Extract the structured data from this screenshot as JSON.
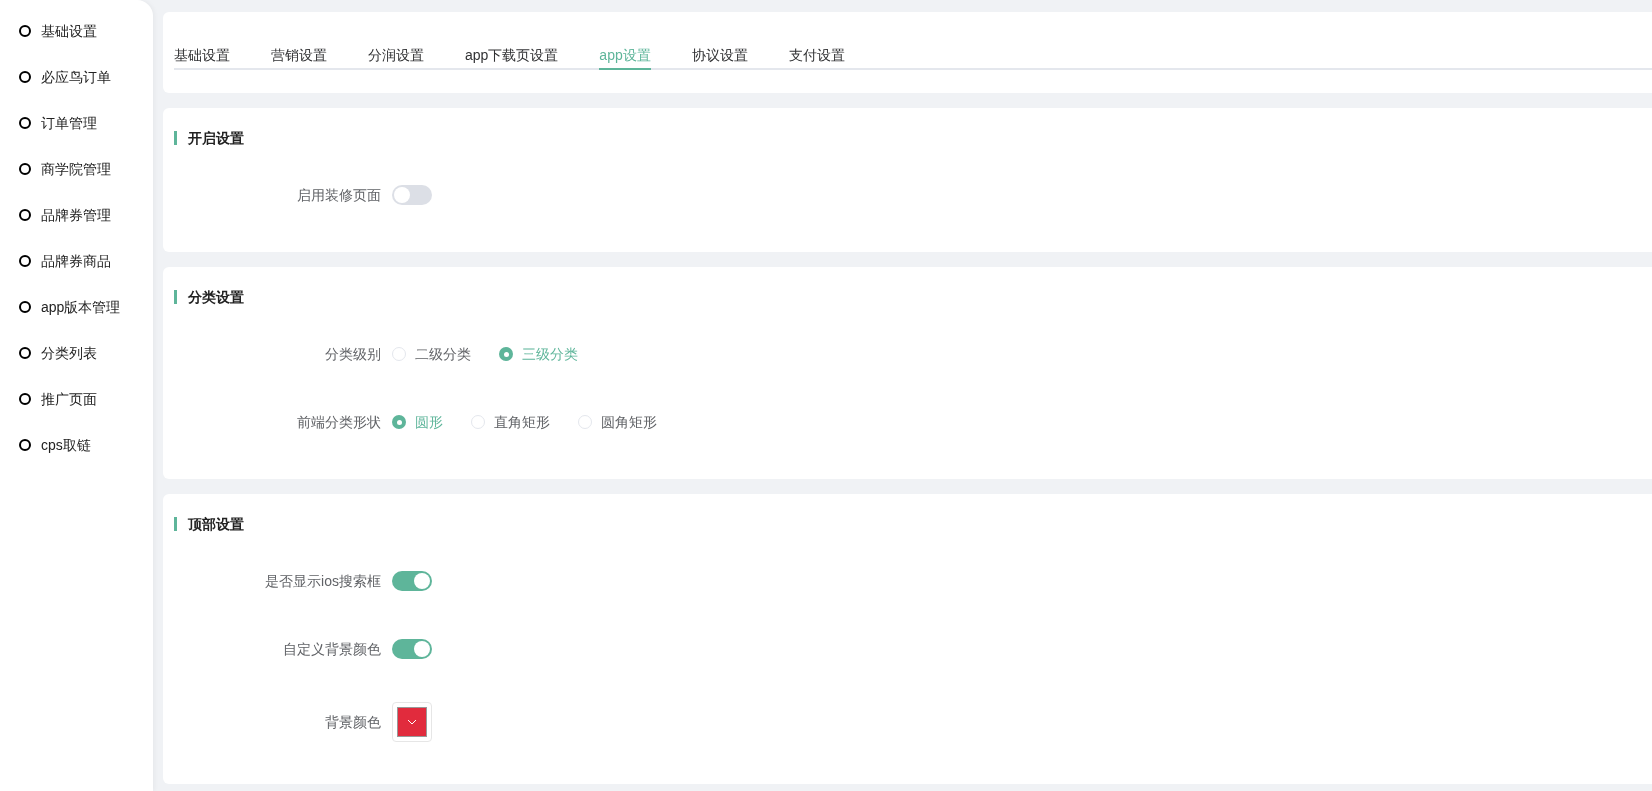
{
  "sidebar": {
    "items": [
      {
        "label": "基础设置"
      },
      {
        "label": "必应鸟订单"
      },
      {
        "label": "订单管理"
      },
      {
        "label": "商学院管理"
      },
      {
        "label": "品牌券管理"
      },
      {
        "label": "品牌券商品"
      },
      {
        "label": "app版本管理"
      },
      {
        "label": "分类列表"
      },
      {
        "label": "推广页面"
      },
      {
        "label": "cps取链"
      }
    ]
  },
  "tabs": [
    {
      "label": "基础设置",
      "selected": false
    },
    {
      "label": "营销设置",
      "selected": false
    },
    {
      "label": "分润设置",
      "selected": false
    },
    {
      "label": "app下载页设置",
      "selected": false
    },
    {
      "label": "app设置",
      "selected": true
    },
    {
      "label": "协议设置",
      "selected": false
    },
    {
      "label": "支付设置",
      "selected": false
    }
  ],
  "sections": [
    {
      "title": "开启设置",
      "rows": [
        {
          "kind": "switch",
          "label": "启用装修页面",
          "on": false
        }
      ]
    },
    {
      "title": "分类设置",
      "rows": [
        {
          "kind": "radio",
          "label": "分类级别",
          "options": [
            {
              "label": "二级分类",
              "selected": false
            },
            {
              "label": "三级分类",
              "selected": true
            }
          ]
        },
        {
          "kind": "radio",
          "label": "前端分类形状",
          "options": [
            {
              "label": "圆形",
              "selected": true
            },
            {
              "label": "直角矩形",
              "selected": false
            },
            {
              "label": "圆角矩形",
              "selected": false
            }
          ]
        }
      ]
    },
    {
      "title": "顶部设置",
      "rows": [
        {
          "kind": "switch",
          "label": "是否显示ios搜索框",
          "on": true
        },
        {
          "kind": "switch",
          "label": "自定义背景颜色",
          "on": true
        },
        {
          "kind": "color",
          "label": "背景颜色",
          "color": "#e12b3d"
        }
      ]
    }
  ]
}
